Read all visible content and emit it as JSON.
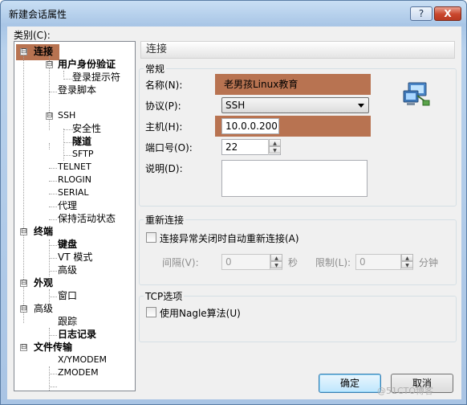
{
  "window": {
    "title": "新建会话属性",
    "help_label": "?",
    "close_label": "X"
  },
  "category_label": "类别(C):",
  "tree": [
    {
      "label": "连接",
      "toggle": "⊟"
    },
    {
      "label": "用户身份验证",
      "toggle": "⊟"
    },
    {
      "label": "登录提示符"
    },
    {
      "label": "登录脚本"
    },
    {
      "label": "SSH",
      "toggle": "⊟"
    },
    {
      "label": "安全性"
    },
    {
      "label": "隧道"
    },
    {
      "label": "SFTP"
    },
    {
      "label": "TELNET"
    },
    {
      "label": "RLOGIN"
    },
    {
      "label": "SERIAL"
    },
    {
      "label": "代理"
    },
    {
      "label": "保持活动状态"
    },
    {
      "label": "终端",
      "toggle": "⊟"
    },
    {
      "label": "键盘"
    },
    {
      "label": "VT 模式"
    },
    {
      "label": "高级"
    },
    {
      "label": "外观",
      "toggle": "⊟"
    },
    {
      "label": "窗口"
    },
    {
      "label": "高级",
      "toggle": "⊟"
    },
    {
      "label": "跟踪"
    },
    {
      "label": "日志记录"
    },
    {
      "label": "文件传输",
      "toggle": "⊟"
    },
    {
      "label": "X/YMODEM"
    },
    {
      "label": "ZMODEM"
    }
  ],
  "panel_title": "连接",
  "general": {
    "group_title": "常规",
    "name_label": "名称(N):",
    "name_value": "老男孩Linux教育",
    "protocol_label": "协议(P):",
    "protocol_value": "SSH",
    "host_label": "主机(H):",
    "host_value": "10.0.0.200",
    "port_label": "端口号(O):",
    "port_value": "22",
    "desc_label": "说明(D):",
    "desc_value": ""
  },
  "reconnect": {
    "group_title": "重新连接",
    "checkbox_label": "连接异常关闭时自动重新连接(A)",
    "interval_label": "间隔(V):",
    "interval_value": "0",
    "seconds_label": "秒",
    "limit_label": "限制(L):",
    "limit_value": "0",
    "minutes_label": "分钟"
  },
  "tcp": {
    "group_title": "TCP选项",
    "nagle_label": "使用Nagle算法(U)"
  },
  "buttons": {
    "ok": "确定",
    "cancel": "取消"
  },
  "watermark": "@51CTO博客",
  "colors": {
    "highlight": "#b87351",
    "title_bar": "#a9c6e6"
  }
}
